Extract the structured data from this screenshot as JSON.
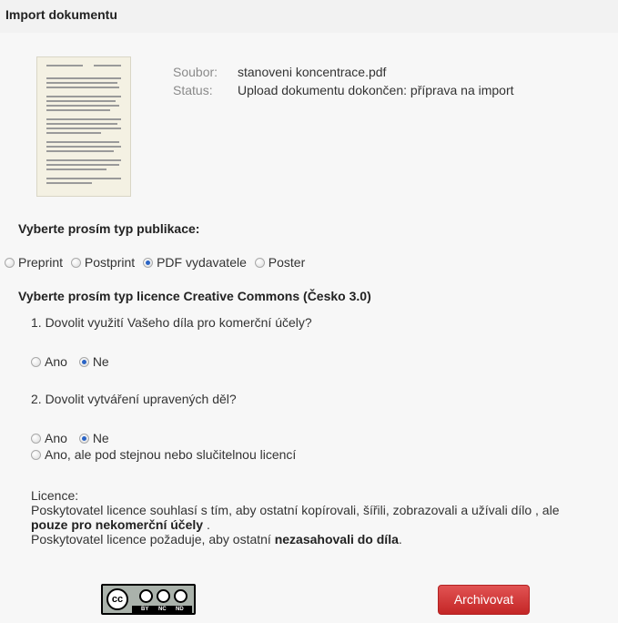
{
  "header": {
    "title": "Import dokumentu"
  },
  "file": {
    "file_label": "Soubor:",
    "file_name": "stanoveni koncentrace.pdf",
    "status_label": "Status:",
    "status_value": "Upload dokumentu dokončen: příprava na import"
  },
  "publication": {
    "heading": "Vyberte prosím typ publikace:",
    "options": [
      "Preprint",
      "Postprint",
      "PDF vydavatele",
      "Poster"
    ],
    "selected": "PDF vydavatele"
  },
  "licence_type": {
    "heading": "Vyberte prosím typ licence Creative Commons (Česko 3.0)",
    "q1": {
      "text": "1. Dovolit využití Vašeho díla pro komerční účely?",
      "options": [
        "Ano",
        "Ne"
      ],
      "selected": "Ne"
    },
    "q2": {
      "text": "2. Dovolit vytváření upravených děl?",
      "options": [
        "Ano",
        "Ne",
        "Ano, ale pod stejnou nebo slučitelnou licencí"
      ],
      "selected": "Ne"
    }
  },
  "licence": {
    "label": "Licence:",
    "line1_start": "Poskytovatel licence souhlasí s tím, aby ostatní kopírovali, šířili, zobrazovali a užívali dílo , ale",
    "line1_bold": "pouze pro nekomerční účely",
    "line1_end": " .",
    "line2_start": "Poskytovatel licence požaduje, aby ostatní ",
    "line2_bold": "nezasahovali do díla",
    "line2_end": "."
  },
  "cc_badge": {
    "cc": "cc",
    "by": "BY",
    "nc": "NC",
    "nd": "ND"
  },
  "archive_button": {
    "label": "Archivovat"
  }
}
